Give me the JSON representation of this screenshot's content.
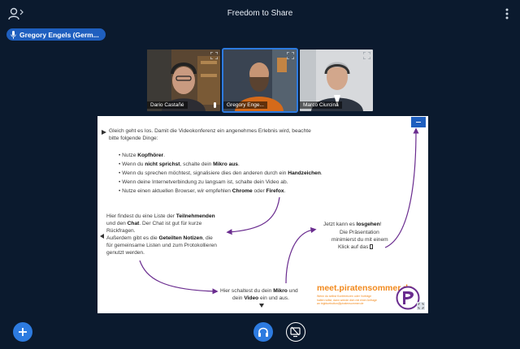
{
  "header": {
    "title": "Freedom to Share",
    "users_icon": "users-icon",
    "more_icon": "more-vertical-icon"
  },
  "presenter": {
    "name": "Gregory Engels (Germ...",
    "icon": "microphone-icon",
    "color": "#1f5fbf"
  },
  "webcams": [
    {
      "name": "Dario Castañé",
      "active": false
    },
    {
      "name": "Gregory Enge...",
      "active": true
    },
    {
      "name": "Marco Ciurcina",
      "active": false
    }
  ],
  "slide": {
    "intro_line1_pre": "Gleich geht es los. Damit die Videokonferenz ein angenehmes Erlebnis wird, beachte",
    "intro_line2": "bitte folgende Dinge:",
    "bullets": [
      {
        "pre": "• Nutze ",
        "bold": "Kopfhörer",
        "post": "."
      },
      {
        "pre": "• Wenn du ",
        "bold": "nicht sprichst",
        "post": ", schalte dein ",
        "bold2": "Mikro aus",
        "post2": "."
      },
      {
        "pre": "• Wenn du sprechen möchtest, signalisiere dies den anderen durch ein ",
        "bold": "Handzeichen",
        "post": "."
      },
      {
        "pre": "• Wenn deine Internetverbindung zu langsam ist, schalte dein Video ab.",
        "bold": "",
        "post": ""
      },
      {
        "pre": "• Nutze einen aktuellen Browser, wir empfehlen ",
        "bold": "Chrome",
        "post": " oder ",
        "bold2": "Firefox",
        "post2": "."
      }
    ],
    "left_block": {
      "l1_pre": "Hier findest du eine Liste der ",
      "l1_bold": "Teilnehmenden",
      "l2_pre": "und den ",
      "l2_bold": "Chat",
      "l2_post": ". Der Chat ist gut für kurze",
      "l3": "Rückfragen.",
      "l4_pre": "Außerdem gibt es die ",
      "l4_bold": "Geteilten Notizen",
      "l4_post": ", die",
      "l5": "für gemeinsame Listen und zum Protokollieren",
      "l6": "genutzt werden."
    },
    "bottom_block": {
      "l1_pre": "Hier schaltest du dein ",
      "l1_bold": "Mikro",
      "l1_post": " und",
      "l2_pre": "dein ",
      "l2_bold": "Video",
      "l2_post": " ein und aus."
    },
    "right_block": {
      "l1_pre": "Jetzt kann es ",
      "l1_bold": "losgehen",
      "l1_post": "!",
      "l2": "Die Präsentation",
      "l3": "minimierst du mit einem",
      "l4": "Klick auf das",
      "l4_icon": "minimize-icon"
    },
    "brand_url": "meet.piratensommer.de",
    "brand_small_1": "Wenn du selbst Konferenzen oder Vorträge",
    "brand_small_2": "halten willst, dann wende dich mit einer Anfrage",
    "brand_small_3": "an bigbluebutton@piratensommer.de",
    "logo_icon": "pirate-party-logo",
    "accent": "#f28a1e",
    "arrow_color": "#6a2c8f"
  },
  "controls": {
    "actions_icon": "plus-icon",
    "audio_icon": "headphones-icon",
    "screen_icon": "screen-share-icon",
    "primary_color": "#2d7be0"
  }
}
